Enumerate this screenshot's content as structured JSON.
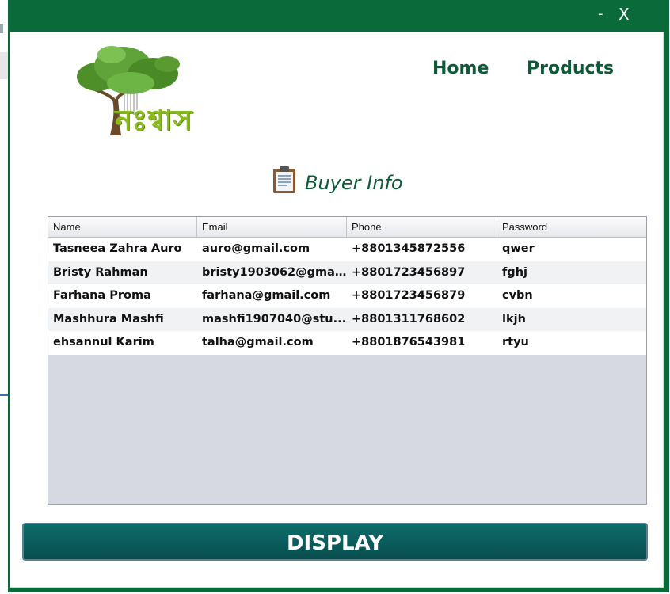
{
  "window": {
    "minimize_label": "-",
    "close_label": "X"
  },
  "logo": {
    "text": "নঃশ্বাস",
    "icon": "tree-icon"
  },
  "nav": {
    "home": "Home",
    "products": "Products"
  },
  "section": {
    "title": "Buyer Info",
    "icon": "clipboard-icon"
  },
  "table": {
    "columns": [
      "Name",
      "Email",
      "Phone",
      "Password"
    ],
    "rows": [
      [
        "Tasneea Zahra Auro",
        "auro@gmail.com",
        "+8801345872556",
        "qwer"
      ],
      [
        "Bristy Rahman",
        "bristy1903062@gmai...",
        "+8801723456897",
        "fghj"
      ],
      [
        "Farhana Proma",
        "farhana@gmail.com",
        "+8801723456879",
        "cvbn"
      ],
      [
        "Mashhura Mashfi",
        "mashfi1907040@stu...",
        "+8801311768602",
        "lkjh"
      ],
      [
        "ehsannul Karim",
        "talha@gmail.com",
        "+8801876543981",
        "rtyu"
      ]
    ]
  },
  "display_button": "DISPLAY",
  "colors": {
    "frame": "#0a6a3a",
    "accent": "#0c5a36",
    "button": "#0b5d5c"
  }
}
